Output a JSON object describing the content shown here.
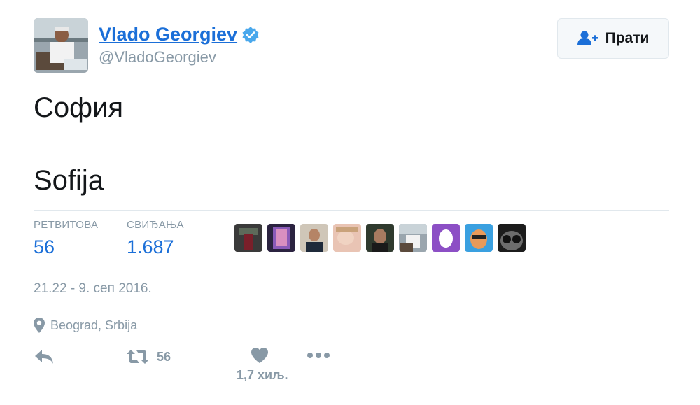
{
  "user": {
    "display_name": "Vlado Georgiev",
    "handle": "@VladoGeorgiev",
    "verified": true
  },
  "follow_button": {
    "label": "Прати",
    "icon": "add-user-icon"
  },
  "tweet": {
    "line1": "София",
    "line2": "Sofija"
  },
  "stats": {
    "retweets_label": "РЕТВИТОВА",
    "retweets_value": "56",
    "likes_label": "СВИЂАЊА",
    "likes_value": "1.687"
  },
  "likers_count_shown": 9,
  "timestamp": "21.22 - 9. сеп 2016.",
  "location": {
    "icon": "map-pin-icon",
    "text": "Beograd, Srbija"
  },
  "actions": {
    "reply_icon": "reply-icon",
    "retweet_icon": "retweet-icon",
    "retweet_count": "56",
    "like_icon": "heart-icon",
    "like_count": "1,7 хиљ.",
    "more_icon": "more-dots-icon"
  },
  "colors": {
    "link_blue": "#1b6fd8",
    "muted_gray": "#8899a6",
    "verified_blue": "#4aa8ec",
    "border": "#e1e8ed"
  }
}
